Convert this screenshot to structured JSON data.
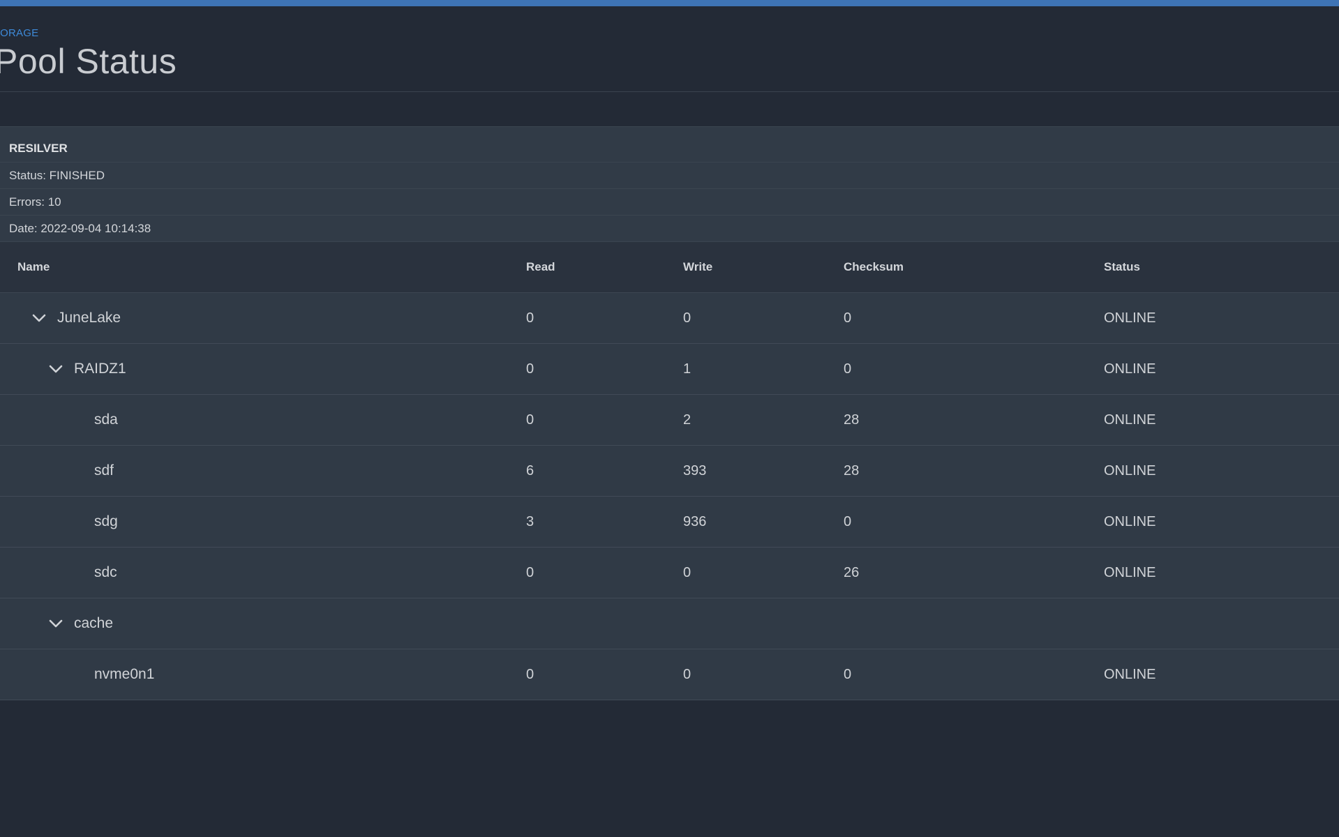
{
  "header": {
    "breadcrumb": "TORAGE",
    "title": "Pool Status"
  },
  "resilver": {
    "title": "RESILVER",
    "status": "Status: FINISHED",
    "errors": "Errors: 10",
    "date": "Date: 2022-09-04 10:14:38"
  },
  "table": {
    "columns": {
      "name": "Name",
      "read": "Read",
      "write": "Write",
      "checksum": "Checksum",
      "status": "Status"
    },
    "rows": [
      {
        "name": "JuneLake",
        "read": "0",
        "write": "0",
        "checksum": "0",
        "status": "ONLINE",
        "expandable": true
      },
      {
        "name": "RAIDZ1",
        "read": "0",
        "write": "1",
        "checksum": "0",
        "status": "ONLINE",
        "expandable": true
      },
      {
        "name": "sda",
        "read": "0",
        "write": "2",
        "checksum": "28",
        "status": "ONLINE",
        "expandable": false
      },
      {
        "name": "sdf",
        "read": "6",
        "write": "393",
        "checksum": "28",
        "status": "ONLINE",
        "expandable": false
      },
      {
        "name": "sdg",
        "read": "3",
        "write": "936",
        "checksum": "0",
        "status": "ONLINE",
        "expandable": false
      },
      {
        "name": "sdc",
        "read": "0",
        "write": "0",
        "checksum": "26",
        "status": "ONLINE",
        "expandable": false
      },
      {
        "name": "cache",
        "read": "",
        "write": "",
        "checksum": "",
        "status": "",
        "expandable": true
      },
      {
        "name": "nvme0n1",
        "read": "0",
        "write": "0",
        "checksum": "0",
        "status": "ONLINE",
        "expandable": false
      }
    ]
  },
  "colors": {
    "accent": "#3e74b6",
    "background": "#232a36",
    "panel": "#303a46"
  },
  "icons": {
    "expand": "chevron-down-icon"
  }
}
